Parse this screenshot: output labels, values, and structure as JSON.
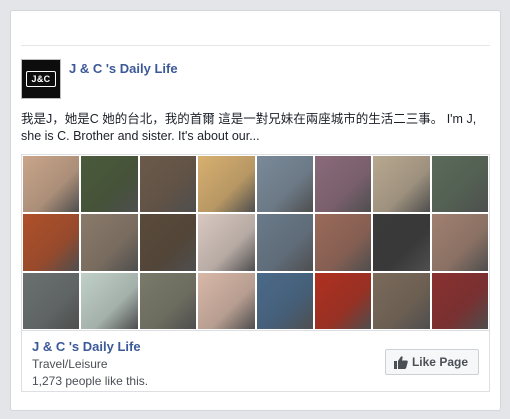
{
  "page": {
    "name": "J & C 's Daily Life",
    "avatar_text": "J&C",
    "description": "我是J，她是C 她的台北，我的首爾 這是一對兄妹在兩座城市的生活二三事。 I'm J, she is C. Brother and sister. It's about our..."
  },
  "footer": {
    "name": "J & C 's Daily Life",
    "category": "Travel/Leisure",
    "likes": "1,273 people like this.",
    "like_button": "Like Page"
  },
  "colors": {
    "link": "#3b5998",
    "text": "#1d2129",
    "muted": "#4b4f56"
  },
  "icons": {
    "like": "thumbs-up-icon"
  },
  "collage_tiles": [
    "#c9a58a",
    "#4a5a3a",
    "#6b5a4a",
    "#d8b070",
    "#7a8a9a",
    "#8a6a7a",
    "#b8a890",
    "#5a6a5a",
    "#b0502a",
    "#8a7a6a",
    "#5a4a3a",
    "#d8c8c0",
    "#6a7a8a",
    "#9a6a5a",
    "#3a3a3a",
    "#a08070",
    "#6a7070",
    "#c0d0c8",
    "#7a7a6a",
    "#d8b8a8",
    "#4a6a8a",
    "#b03020",
    "#7a6a5a",
    "#8a3030"
  ]
}
